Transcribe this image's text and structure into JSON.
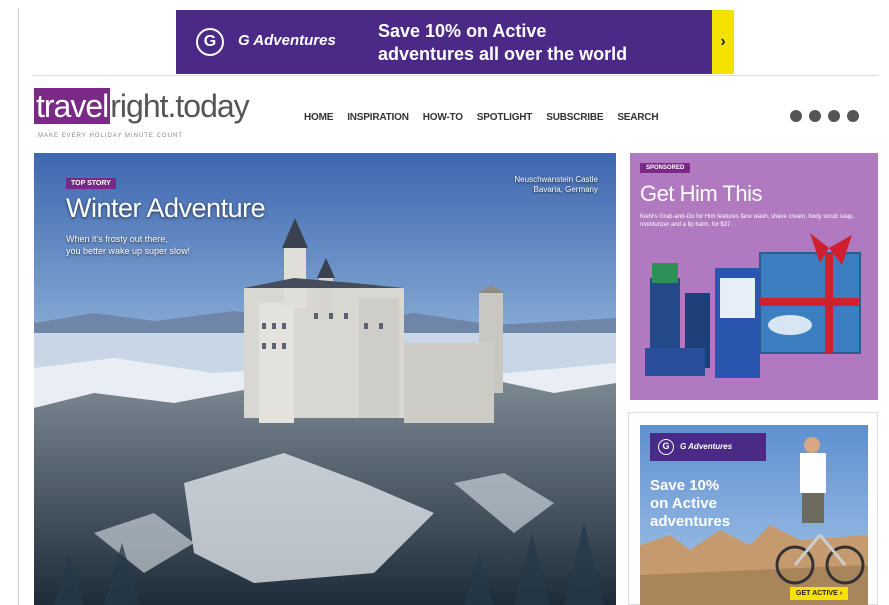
{
  "top_banner": {
    "brand": "G Adventures",
    "logo_letter": "G",
    "message_line1": "Save 10% on Active",
    "message_line2": "adventures all over the world",
    "arrow": "›"
  },
  "header": {
    "logo_highlight": "travel",
    "logo_rest": "right.today",
    "tagline": "MAKE EVERY HOLIDAY MINUTE COUNT",
    "nav": [
      "HOME",
      "INSPIRATION",
      "HOW-TO",
      "SPOTLIGHT",
      "SUBSCRIBE",
      "SEARCH"
    ],
    "social_icons": [
      "facebook-icon",
      "instagram-icon",
      "pinterest-icon",
      "twitter-icon"
    ]
  },
  "hero": {
    "badge": "TOP STORY",
    "title": "Winter Adventure",
    "subtitle_line1": "When it's frosty out there,",
    "subtitle_line2": "you better wake up super slow!",
    "caption_line1": "Neuschwanstein Castle",
    "caption_line2": "Bavaria, Germany"
  },
  "sponsored": {
    "badge": "SPONSORED",
    "title": "Get Him This",
    "description": "Kiehl's Grab-and-Go for Him features face wash, shave cream, body scrub soap, moisturizer and a lip balm, for $37."
  },
  "side_ad": {
    "brand": "G Adventures",
    "logo_letter": "G",
    "msg_line1": "Save 10%",
    "msg_line2": "on Active",
    "msg_line3": "adventures",
    "cta": "GET ACTIVE ›"
  }
}
